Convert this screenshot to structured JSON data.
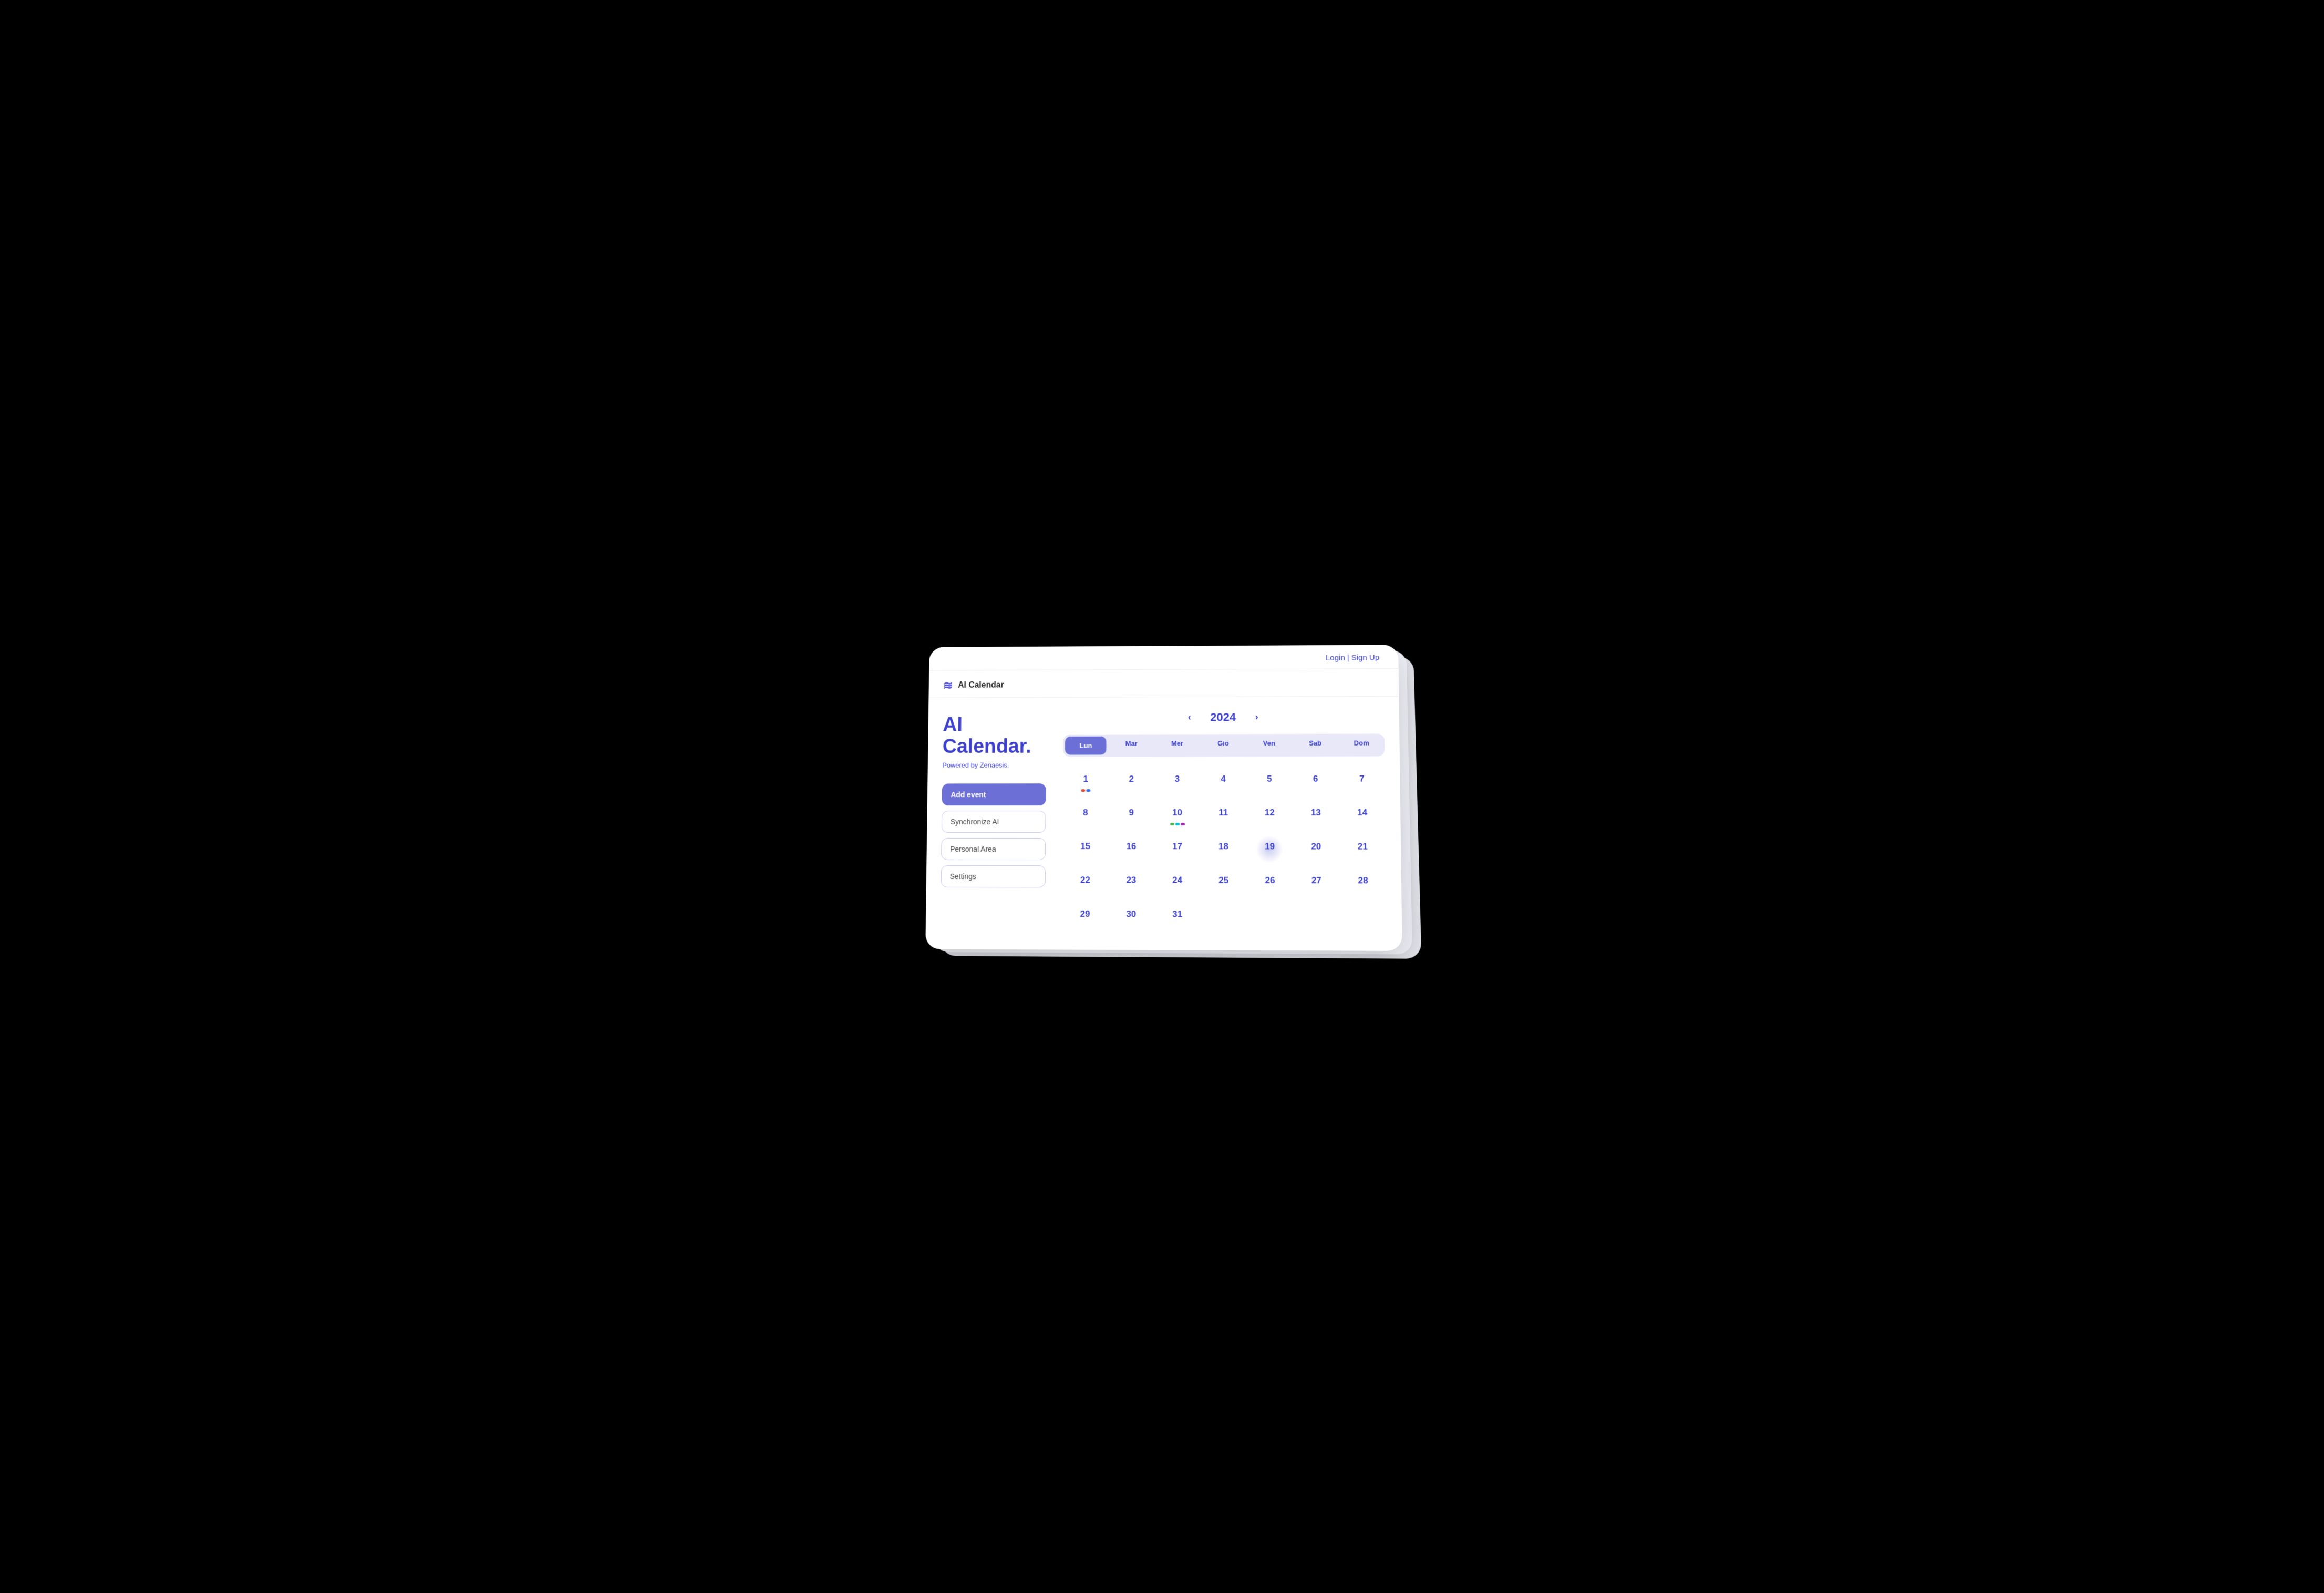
{
  "auth": {
    "login_label": "Login",
    "separator": "|",
    "signup_label": "Sign Up"
  },
  "header": {
    "logo_text": "≋",
    "app_name": "AI Calendar"
  },
  "sidebar": {
    "title": "AI Calendar.",
    "subtitle": "Powered by Zenaesis.",
    "buttons": [
      {
        "id": "add-event",
        "label": "Add event",
        "primary": true
      },
      {
        "id": "sync-ai",
        "label": "Synchronize AI",
        "primary": false
      },
      {
        "id": "personal-area",
        "label": "Personal Area",
        "primary": false
      },
      {
        "id": "settings",
        "label": "Settings",
        "primary": false
      }
    ]
  },
  "calendar": {
    "prev_label": "‹",
    "next_label": "›",
    "year": "2024",
    "day_headers": [
      "Lun",
      "Mar",
      "Mer",
      "Gio",
      "Ven",
      "Sab",
      "Dom"
    ],
    "active_day_header": "Lun",
    "today": 19,
    "month_start_offset": 0,
    "days_in_month": 31,
    "events": {
      "1": [
        "red",
        "blue"
      ],
      "10": [
        "green",
        "cyan",
        "purple"
      ]
    }
  }
}
